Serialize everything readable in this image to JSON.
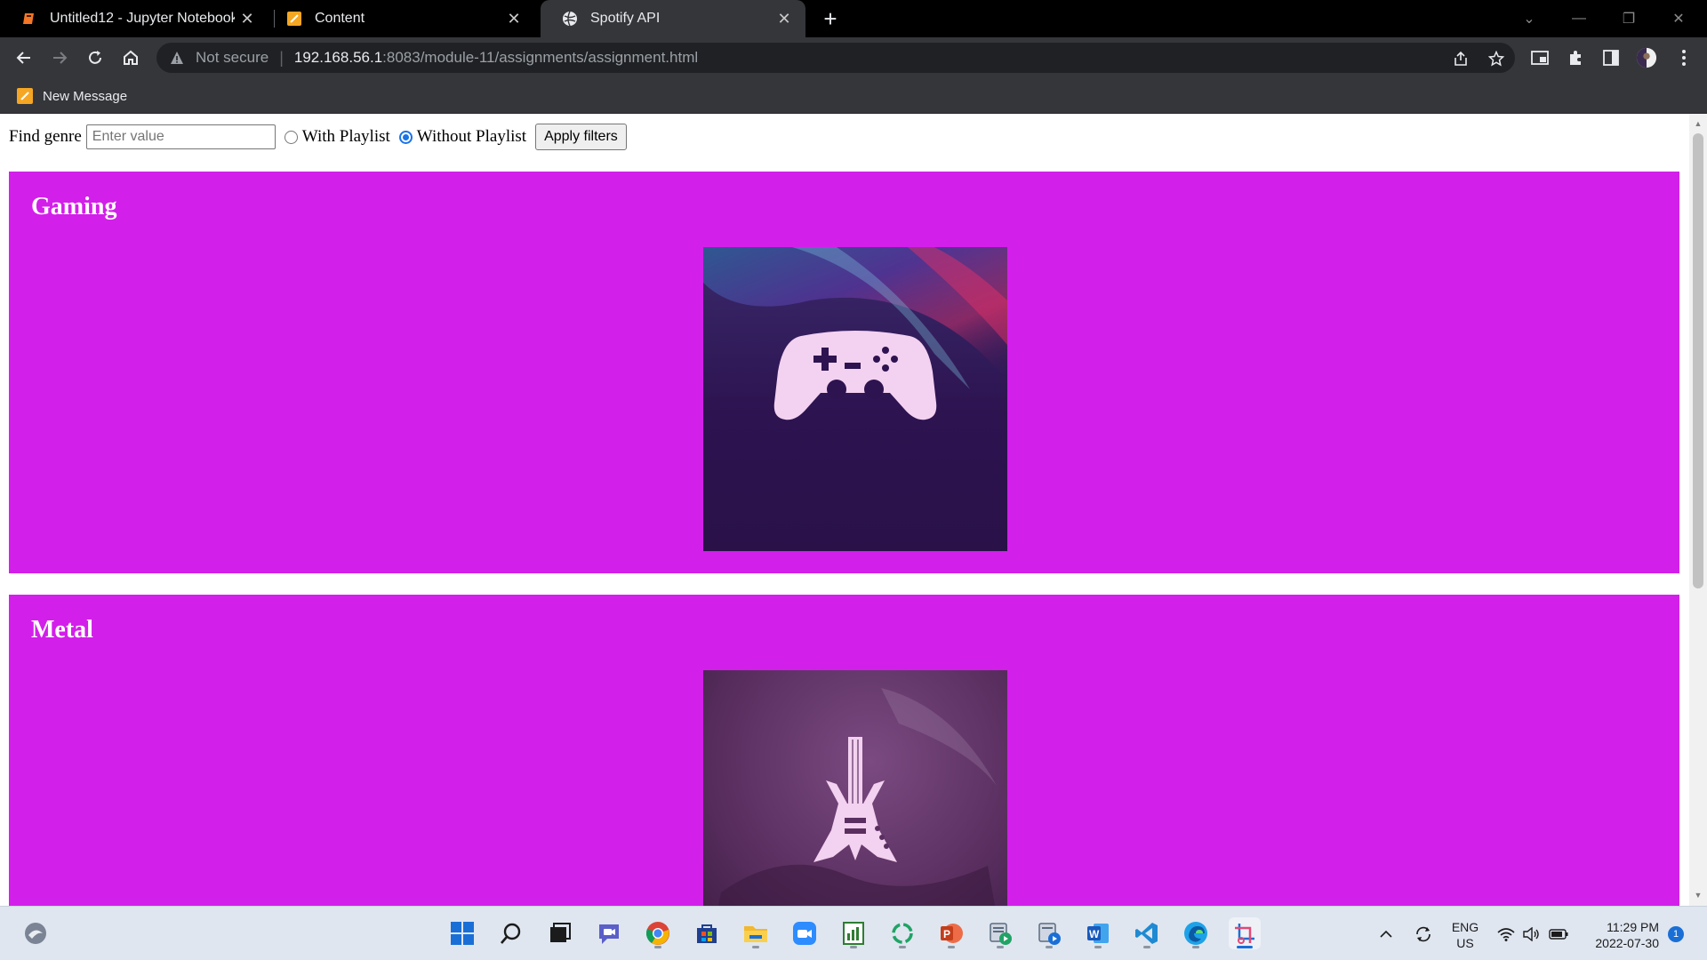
{
  "browser": {
    "tabs": [
      {
        "title": "Untitled12 - Jupyter Notebook",
        "icon": "jupyter-icon",
        "active": false
      },
      {
        "title": "Content",
        "icon": "note-icon",
        "active": false
      },
      {
        "title": "Spotify API",
        "icon": "globe-icon",
        "active": true
      }
    ],
    "address": {
      "security_label": "Not secure",
      "url_host": "192.168.56.1",
      "url_path": ":8083/module-11/assignments/assignment.html"
    },
    "bookmarks": [
      {
        "label": "New Message",
        "icon": "note-icon"
      }
    ]
  },
  "page": {
    "filters": {
      "find_label": "Find genre",
      "input_value": "",
      "input_placeholder": "Enter value",
      "with_playlist_label": "With Playlist",
      "without_playlist_label": "Without Playlist",
      "selected": "without_playlist",
      "apply_label": "Apply filters"
    },
    "genres": [
      {
        "name": "Gaming",
        "image": "gamepad-artwork"
      },
      {
        "name": "Metal",
        "image": "guitar-artwork"
      }
    ],
    "colors": {
      "card_background": "#d31fea",
      "card_text": "#ffffff"
    }
  },
  "taskbar": {
    "language": {
      "line1": "ENG",
      "line2": "US"
    },
    "time": "11:29 PM",
    "date": "2022-07-30",
    "notification_count": "1"
  }
}
